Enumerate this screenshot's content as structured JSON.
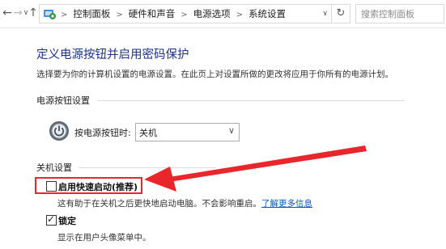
{
  "address_bar": {
    "back_glyph": "←",
    "forward_glyph": "→",
    "recent_glyph": "∨",
    "up_glyph": "↑",
    "icon": "control-panel-icon",
    "breadcrumbs": [
      "控制面板",
      "硬件和声音",
      "电源选项",
      "系统设置"
    ],
    "separator": ">",
    "dropdown_glyph": "∨",
    "refresh_glyph": "↻",
    "search_placeholder": "搜索控制面板"
  },
  "page": {
    "title": "定义电源按钮并启用密码保护",
    "description": "选择要为你的计算机设置的电源设置。在此页上对设置所做的更改将应用于你所有的电源计划。"
  },
  "power_button_settings": {
    "section_label": "电源按钮设置",
    "icon": "power-icon",
    "label": "按电源按钮时:",
    "selected_value": "关机",
    "arrow_glyph": "∨"
  },
  "shutdown_settings": {
    "section_label": "关机设置",
    "fast_startup": {
      "label": "启用快速启动(推荐)",
      "checked": false,
      "hint": "这有助于在关机之后更快地启动电脑。不会影响重启。",
      "link": "了解更多信息"
    },
    "lock": {
      "label": "锁定",
      "checked": true,
      "check_glyph": "✓",
      "hint": "显示在用户头像菜单中。"
    }
  },
  "colors": {
    "title_blue": "#1e3287",
    "link_blue": "#0b57c0",
    "annotation_red": "#e8262c"
  }
}
